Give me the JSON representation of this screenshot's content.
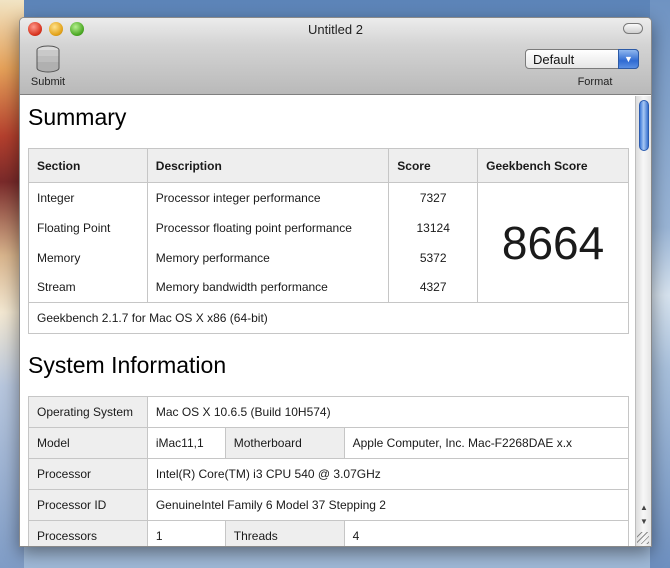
{
  "window": {
    "title": "Untitled 2"
  },
  "toolbar": {
    "submit_label": "Submit",
    "submit_icon": "database-icon",
    "format_label": "Format",
    "format_selected": "Default"
  },
  "summary": {
    "heading": "Summary",
    "columns": [
      "Section",
      "Description",
      "Score",
      "Geekbench Score"
    ],
    "rows": [
      {
        "section": "Integer",
        "description": "Processor integer performance",
        "score": "7327"
      },
      {
        "section": "Floating Point",
        "description": "Processor floating point performance",
        "score": "13124"
      },
      {
        "section": "Memory",
        "description": "Memory performance",
        "score": "5372"
      },
      {
        "section": "Stream",
        "description": "Memory bandwidth performance",
        "score": "4327"
      }
    ],
    "geekbench_score": "8664",
    "footer": "Geekbench 2.1.7 for Mac OS X x86 (64-bit)"
  },
  "system": {
    "heading": "System Information",
    "operating_system_label": "Operating System",
    "operating_system": "Mac OS X 10.6.5 (Build 10H574)",
    "model_label": "Model",
    "model": "iMac11,1",
    "motherboard_label": "Motherboard",
    "motherboard": "Apple Computer, Inc. Mac-F2268DAE x.x",
    "processor_label": "Processor",
    "processor": "Intel(R) Core(TM) i3 CPU 540 @ 3.07GHz",
    "processor_id_label": "Processor ID",
    "processor_id": "GenuineIntel Family 6 Model 37 Stepping 2",
    "processors_label": "Processors",
    "processors": "1",
    "threads_label": "Threads",
    "threads": "4"
  },
  "colors": {
    "header_bg": "#eeeeee",
    "border": "#c6c6c6",
    "scroll_accent": "#3a72cf"
  }
}
